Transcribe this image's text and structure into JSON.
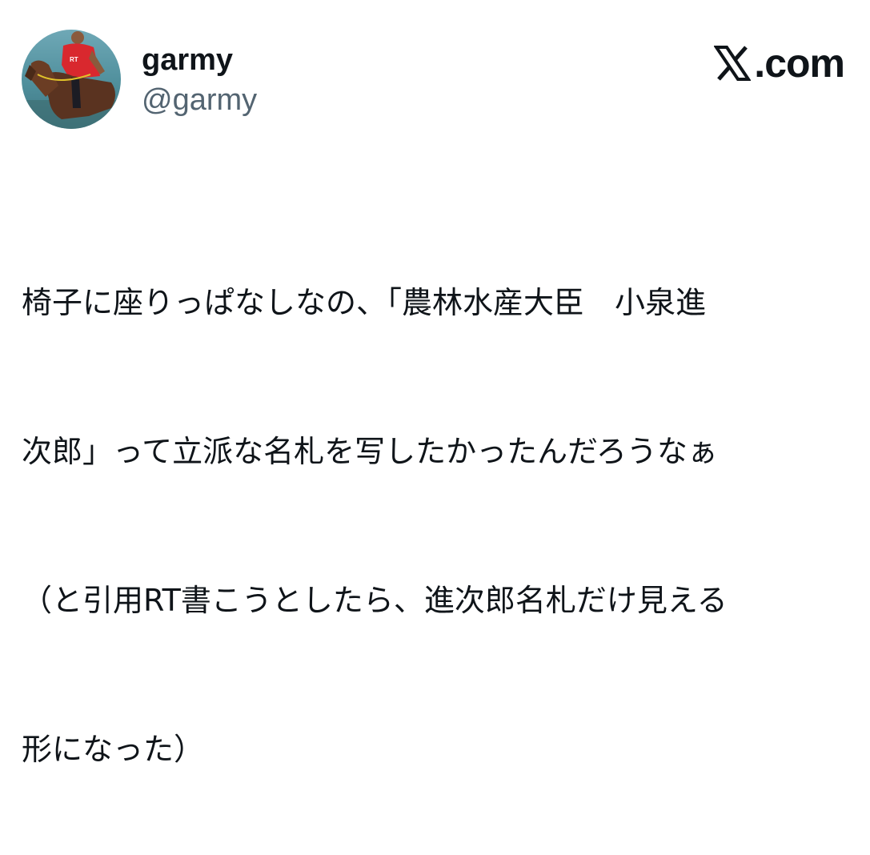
{
  "author": {
    "display_name": "garmy",
    "handle": "@garmy",
    "avatar_icon": "avatar-photo-horse-rider-icon"
  },
  "brand": {
    "logo_icon": "x-logo-icon",
    "text": ".com"
  },
  "tweet": {
    "lines": [
      "椅子に座りっぱなしなの、「農林水産大臣　小泉進",
      "次郎」って立派な名札を写したかったんだろうなぁ",
      "（と引用RT書こうとしたら、進次郎名札だけ見える",
      "形になった）"
    ]
  },
  "colors": {
    "text_primary": "#0f1419",
    "text_secondary": "#536471",
    "background": "#ffffff"
  }
}
